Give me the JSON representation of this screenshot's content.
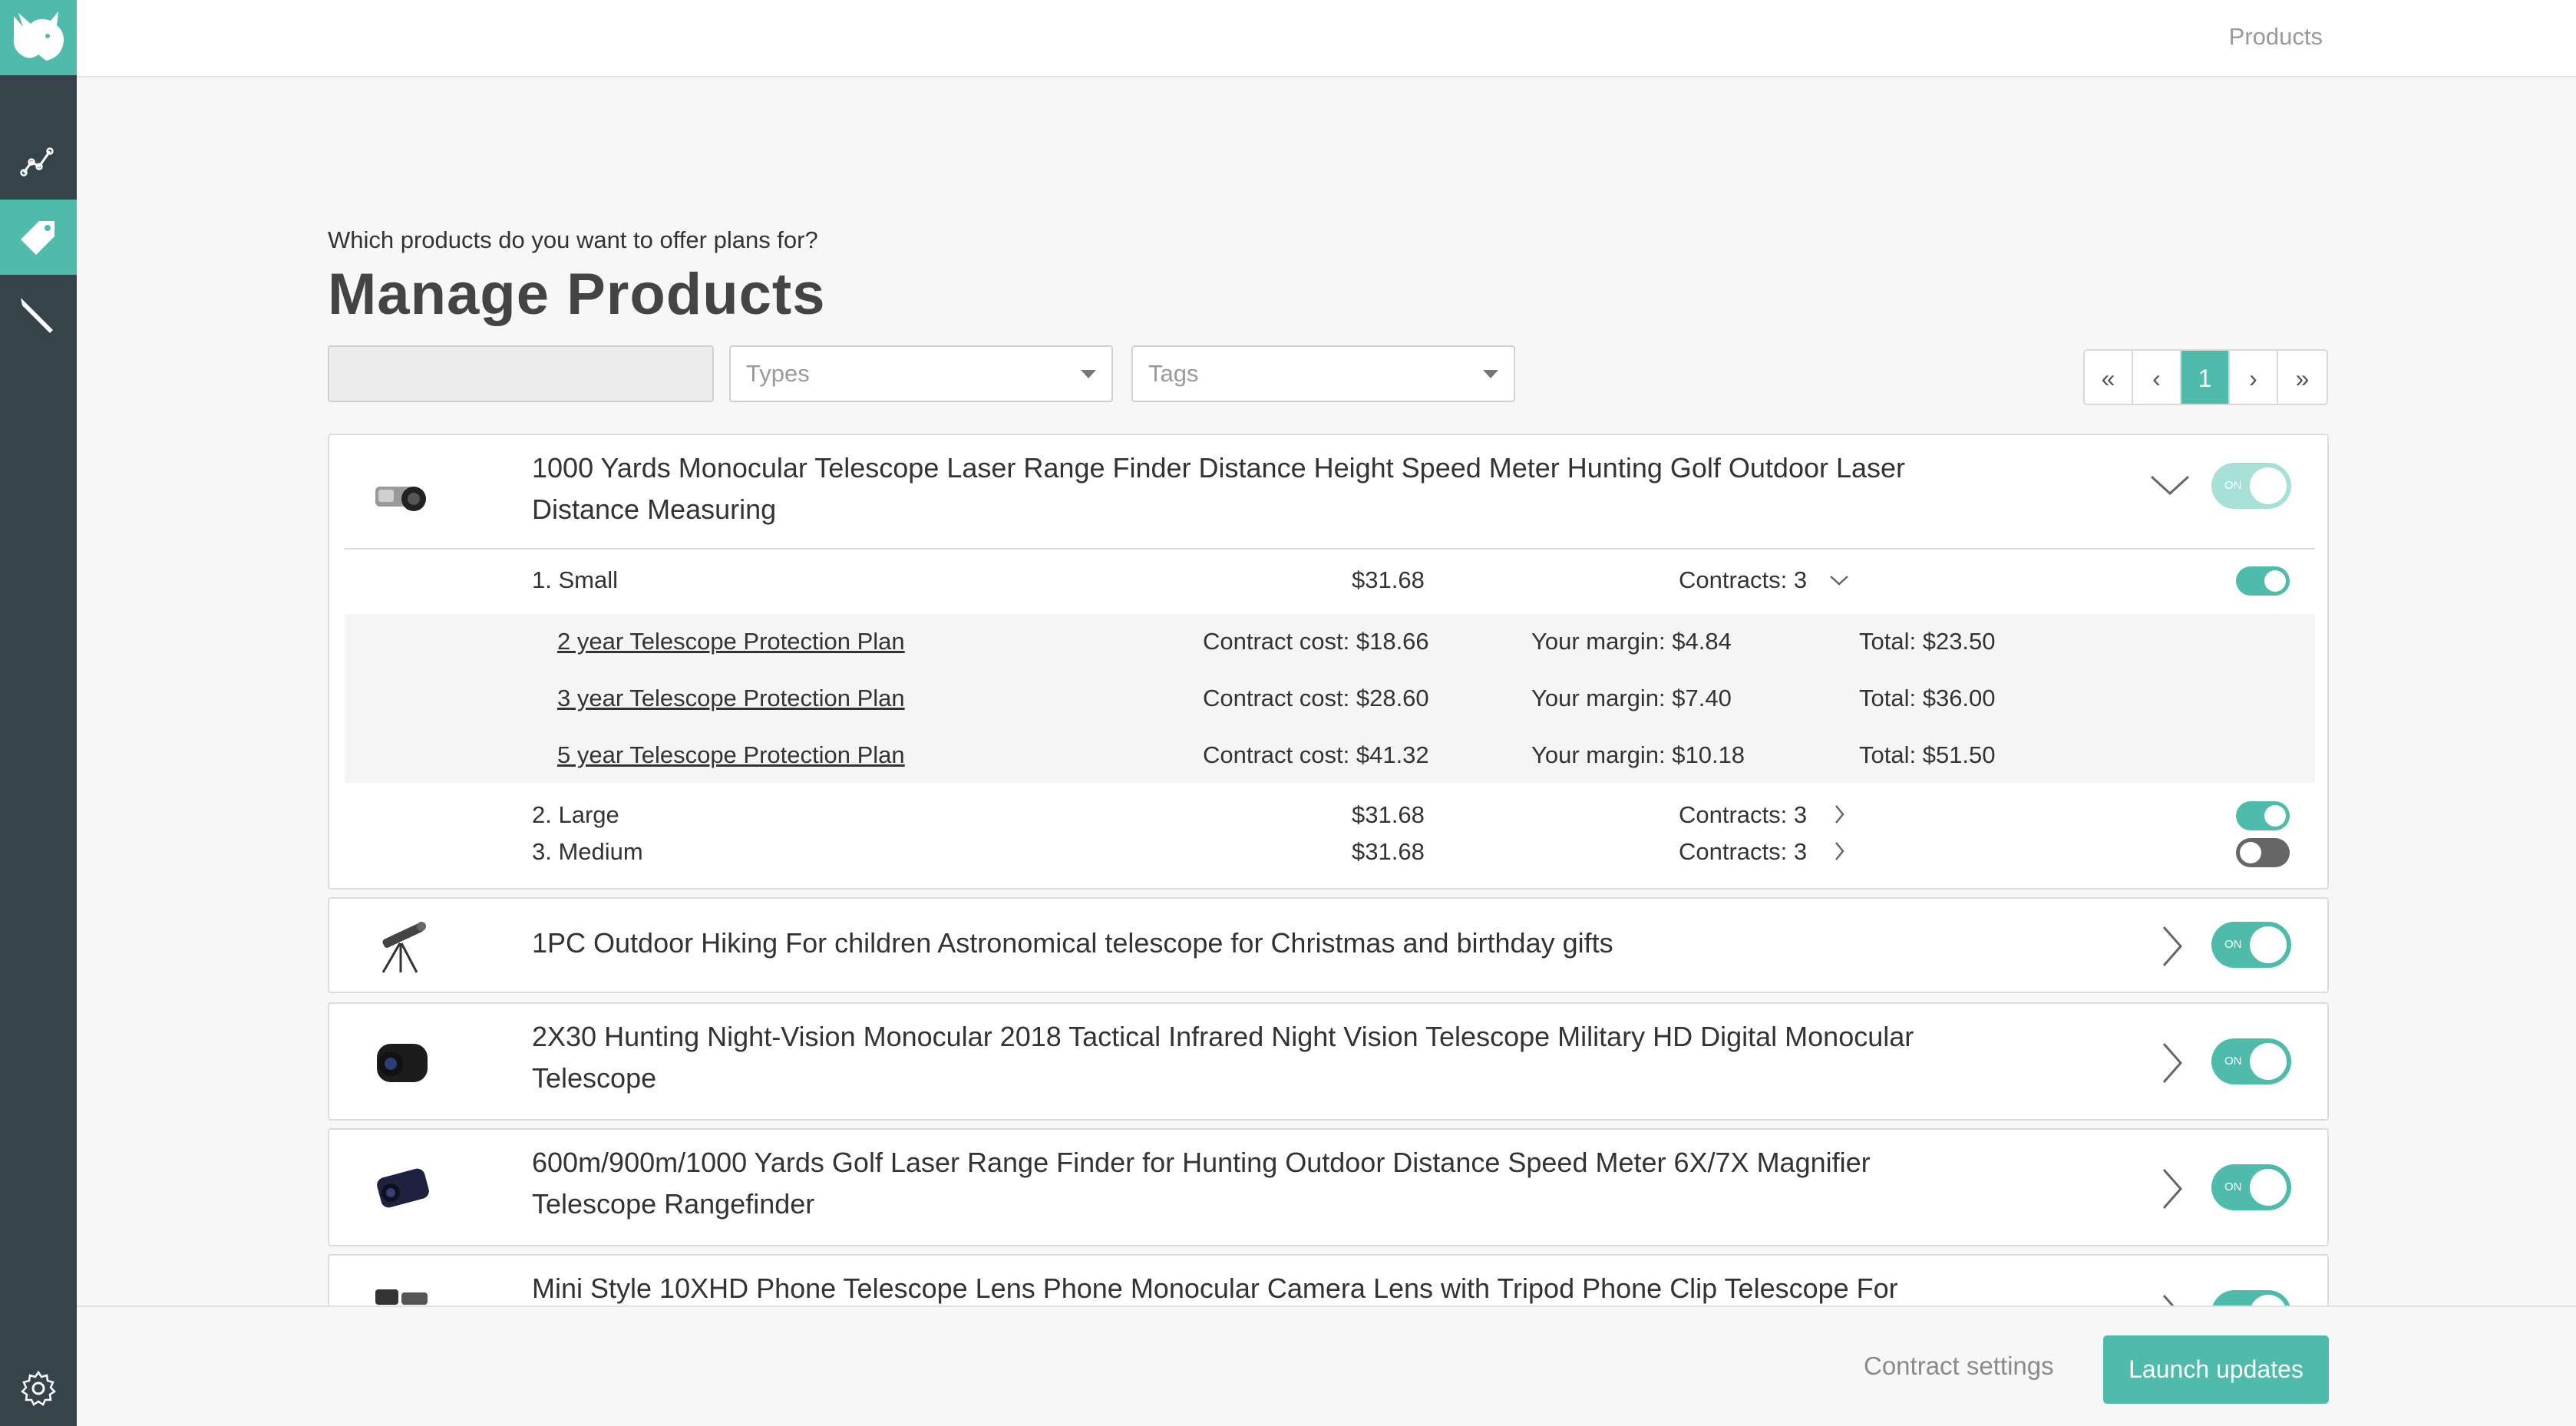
{
  "topbar": {
    "products_link": "Products"
  },
  "sidebar": {
    "logo": "rhino-logo-icon",
    "items": [
      {
        "icon": "analytics-icon",
        "active": false
      },
      {
        "icon": "tag-icon",
        "active": true
      },
      {
        "icon": "pencil-icon",
        "active": false
      },
      {
        "icon": "gear-icon",
        "active": false
      }
    ]
  },
  "header": {
    "subtitle": "Which products do you want to offer plans for?",
    "title": "Manage Products"
  },
  "filters": {
    "search_value": "",
    "types_placeholder": "Types",
    "tags_placeholder": "Tags"
  },
  "pagination": {
    "first": "«",
    "prev": "‹",
    "current": "1",
    "next": "›",
    "last": "»"
  },
  "products": [
    {
      "title_line1": "1000 Yards Monocular Telescope Laser Range Finder Distance Height Speed Meter Hunting Golf Outdoor Laser",
      "title_line2": "Distance Measuring",
      "enabled": true,
      "toggle_label": "ON",
      "expanded": true,
      "variants": [
        {
          "name": "1. Small",
          "price": "$31.68",
          "contracts": "Contracts: 3",
          "enabled": true,
          "expanded": true,
          "plans": [
            {
              "name": "2 year Telescope Protection Plan",
              "cost": "Contract cost: $18.66",
              "margin": "Your margin: $4.84",
              "total": "Total: $23.50"
            },
            {
              "name": "3 year Telescope Protection Plan",
              "cost": "Contract cost: $28.60",
              "margin": "Your margin: $7.40",
              "total": "Total: $36.00"
            },
            {
              "name": "5 year Telescope Protection Plan",
              "cost": "Contract cost: $41.32",
              "margin": "Your margin: $10.18",
              "total": "Total: $51.50"
            }
          ]
        },
        {
          "name": "2. Large",
          "price": "$31.68",
          "contracts": "Contracts: 3",
          "enabled": true,
          "expanded": false
        },
        {
          "name": "3. Medium",
          "price": "$31.68",
          "contracts": "Contracts: 3",
          "enabled": false,
          "expanded": false
        }
      ]
    },
    {
      "title_line1": "1PC Outdoor Hiking For children Astronomical telescope for Christmas and birthday gifts",
      "title_line2": "",
      "enabled": true,
      "toggle_label": "ON",
      "expanded": false
    },
    {
      "title_line1": "2X30 Hunting Night-Vision Monocular 2018 Tactical Infrared Night Vision Telescope Military HD Digital Monocular",
      "title_line2": "Telescope",
      "enabled": true,
      "toggle_label": "ON",
      "expanded": false
    },
    {
      "title_line1": "600m/900m/1000 Yards Golf Laser Range Finder for Hunting Outdoor Distance Speed Meter 6X/7X Magnifier",
      "title_line2": "Telescope Rangefinder",
      "enabled": true,
      "toggle_label": "ON",
      "expanded": false
    },
    {
      "title_line1": "Mini Style 10XHD Phone Telescope Lens Phone Monocular Camera Lens with Tripod Phone Clip Telescope For",
      "title_line2": "",
      "enabled": true,
      "toggle_label": "ON",
      "expanded": false
    }
  ],
  "footer": {
    "contract_settings": "Contract settings",
    "launch_updates": "Launch updates"
  },
  "colors": {
    "accent": "#4fbcab",
    "sidebar": "#36434a",
    "toggle_off": "#666666"
  }
}
